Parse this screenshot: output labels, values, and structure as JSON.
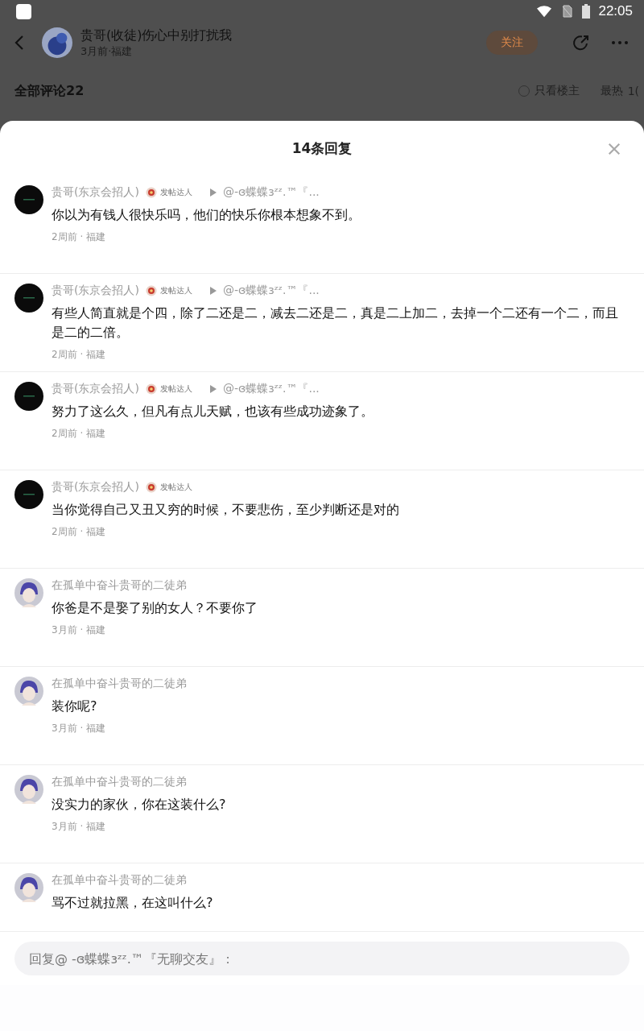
{
  "status_bar": {
    "time": "22:05"
  },
  "post_header": {
    "author": "贵哥(收徒)伤心中别打扰我",
    "meta": "3月前·福建",
    "follow_button": "关注"
  },
  "comments_bar": {
    "title": "全部评论22",
    "only_op": {
      "label": "只看楼主",
      "checked": false
    },
    "sort": "最热",
    "sort_extra": "1("
  },
  "sheet": {
    "title": "14条回复"
  },
  "replies": [
    {
      "kind": "dark",
      "author": "贵哥(东京会招人)",
      "badge": "发帖达人",
      "reply_to": "@-ɞ蝶蝶ɜᶻᶻ.™『...",
      "text": "你以为有钱人很快乐吗，他们的快乐你根本想象不到。",
      "time": "2周前 · 福建"
    },
    {
      "kind": "dark",
      "author": "贵哥(东京会招人)",
      "badge": "发帖达人",
      "reply_to": "@-ɞ蝶蝶ɜᶻᶻ.™『...",
      "text": "有些人简直就是个四，除了二还是二，减去二还是二，真是二上加二，去掉一个二还有一个二，而且是二的二倍。",
      "time": "2周前 · 福建"
    },
    {
      "kind": "dark",
      "author": "贵哥(东京会招人)",
      "badge": "发帖达人",
      "reply_to": "@-ɞ蝶蝶ɜᶻᶻ.™『...",
      "text": "努力了这么久，但凡有点儿天赋，也该有些成功迹象了。",
      "time": "2周前 · 福建"
    },
    {
      "kind": "dark",
      "author": "贵哥(东京会招人)",
      "badge": "发帖达人",
      "text": "当你觉得自己又丑又穷的时候，不要悲伤，至少判断还是对的",
      "time": "2周前 · 福建"
    },
    {
      "kind": "figure",
      "author": "在孤单中奋斗贵哥的二徒弟",
      "text": "你爸是不是娶了别的女人？不要你了",
      "time": "3月前 · 福建"
    },
    {
      "kind": "figure",
      "author": "在孤单中奋斗贵哥的二徒弟",
      "text": "装你呢?",
      "time": "3月前 · 福建"
    },
    {
      "kind": "figure",
      "author": "在孤单中奋斗贵哥的二徒弟",
      "text": "没实力的家伙，你在这装什么?",
      "time": "3月前 · 福建"
    },
    {
      "kind": "figure",
      "author": "在孤单中奋斗贵哥的二徒弟",
      "text": "骂不过就拉黑，在这叫什么?"
    }
  ],
  "reply_input": {
    "placeholder": "回复@ -ɞ蝶蝶ɜᶻᶻ.™『无聊交友』："
  }
}
